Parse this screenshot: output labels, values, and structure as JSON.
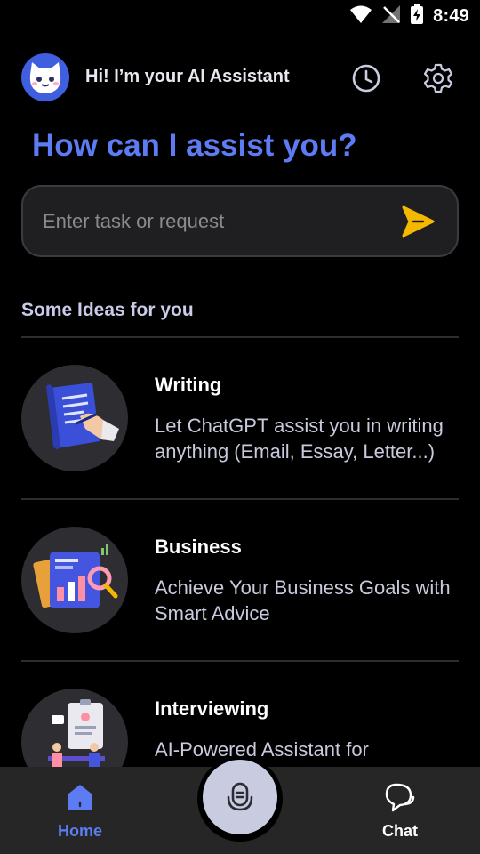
{
  "status_bar": {
    "time": "8:49"
  },
  "header": {
    "greeting": "Hi! I’m your AI Assistant"
  },
  "main": {
    "title": "How can I assist you?"
  },
  "search": {
    "placeholder": "Enter task or request"
  },
  "ideas_section": {
    "title": "Some Ideas for you",
    "items": [
      {
        "title": "Writing",
        "description": "Let ChatGPT assist you in writing anything (Email, Essay, Letter...)"
      },
      {
        "title": "Business",
        "description": "Achieve Your Business Goals with Smart Advice"
      },
      {
        "title": "Interviewing",
        "description": "AI-Powered Assistant for Interviews"
      }
    ]
  },
  "bottom_nav": {
    "items": [
      {
        "label": "Home",
        "icon": "home-icon",
        "active": true
      },
      {
        "label": "Chat",
        "icon": "chat-icon",
        "active": false
      }
    ],
    "center_icon": "microphone-icon"
  },
  "colors": {
    "accent": "#5d7bf2",
    "send": "#f5b800",
    "background": "#000000",
    "nav_background": "#262626",
    "thumb_background": "#2d2d32"
  }
}
